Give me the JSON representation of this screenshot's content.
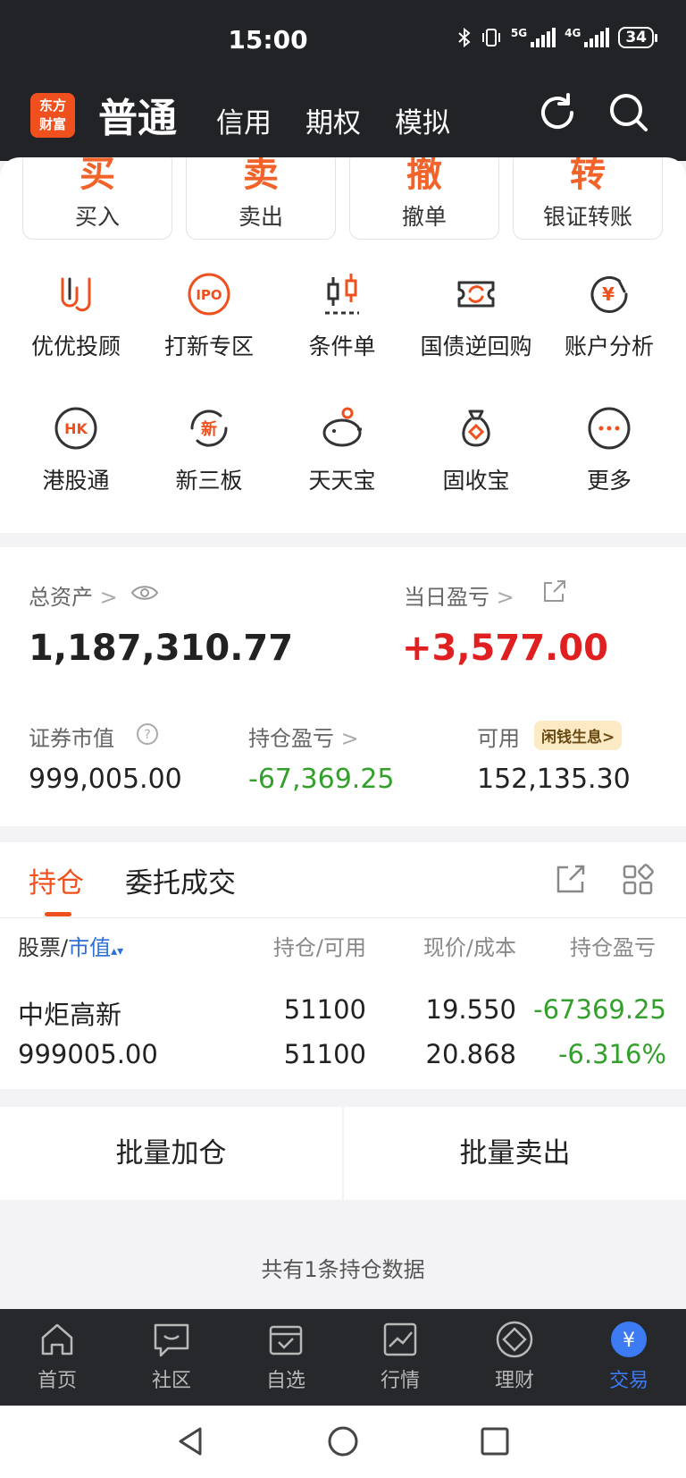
{
  "status": {
    "time": "15:00",
    "network_5g": "5G",
    "network_4g": "4G",
    "battery": "34"
  },
  "top_nav": {
    "logo_line1": "东方",
    "logo_line2": "财富",
    "main_title": "普通",
    "tabs": [
      "信用",
      "期权",
      "模拟"
    ],
    "icons": [
      "refresh-icon",
      "search-icon"
    ]
  },
  "quick_actions": [
    {
      "big": "买",
      "label": "买入"
    },
    {
      "big": "卖",
      "label": "卖出"
    },
    {
      "big": "撤",
      "label": "撤单"
    },
    {
      "big": "转",
      "label": "银证转账"
    }
  ],
  "grid_row1": [
    {
      "label": "优优投顾",
      "icon": "youyou-icon",
      "icon_text": ""
    },
    {
      "label": "打新专区",
      "icon": "ipo-icon",
      "icon_text": "IPO"
    },
    {
      "label": "条件单",
      "icon": "candlestick-icon",
      "icon_text": ""
    },
    {
      "label": "国债逆回购",
      "icon": "bond-repo-icon",
      "icon_text": ""
    },
    {
      "label": "账户分析",
      "icon": "account-analysis-icon",
      "icon_text": "¥"
    }
  ],
  "grid_row2": [
    {
      "label": "港股通",
      "icon": "hk-icon",
      "icon_text": "HK"
    },
    {
      "label": "新三板",
      "icon": "new-third-board-icon",
      "icon_text": "新"
    },
    {
      "label": "天天宝",
      "icon": "piggy-bank-icon",
      "icon_text": ""
    },
    {
      "label": "固收宝",
      "icon": "money-bag-icon",
      "icon_text": ""
    },
    {
      "label": "更多",
      "icon": "more-icon",
      "icon_text": ""
    }
  ],
  "assets": {
    "total_label": "总资产",
    "total_value": "1,187,310.77",
    "daily_pnl_label": "当日盈亏",
    "daily_pnl_value": "+3,577.00",
    "market_value_label": "证券市值",
    "market_value": "999,005.00",
    "position_pnl_label": "持仓盈亏",
    "position_pnl": "-67,369.25",
    "available_label": "可用",
    "available_value": "152,135.30",
    "badge": "闲钱生息>"
  },
  "holdings": {
    "tabs": [
      "持仓",
      "委托成交"
    ],
    "columns": {
      "stock": "股票/",
      "sort": "市值",
      "qty": "持仓/可用",
      "price": "现价/成本",
      "pnl": "持仓盈亏"
    },
    "rows": [
      {
        "name": "中炬高新",
        "market_value": "999005.00",
        "qty": "51100",
        "available": "51100",
        "price": "19.550",
        "cost": "20.868",
        "pnl": "-67369.25",
        "pnl_pct": "-6.316%"
      }
    ]
  },
  "batch": {
    "add": "批量加仓",
    "sell": "批量卖出"
  },
  "footer_note": "共有1条持仓数据",
  "tab_bar": [
    {
      "label": "首页",
      "icon": "home-icon"
    },
    {
      "label": "社区",
      "icon": "community-icon"
    },
    {
      "label": "自选",
      "icon": "watchlist-icon"
    },
    {
      "label": "行情",
      "icon": "market-icon"
    },
    {
      "label": "理财",
      "icon": "wealth-icon"
    },
    {
      "label": "交易",
      "icon": "trade-icon",
      "symbol": "¥",
      "active": true
    }
  ],
  "colors": {
    "accent": "#f0501e",
    "up": "#e02020",
    "down": "#33a02c",
    "blue": "#2f6fd6",
    "active_tab": "#3d7bf4"
  }
}
